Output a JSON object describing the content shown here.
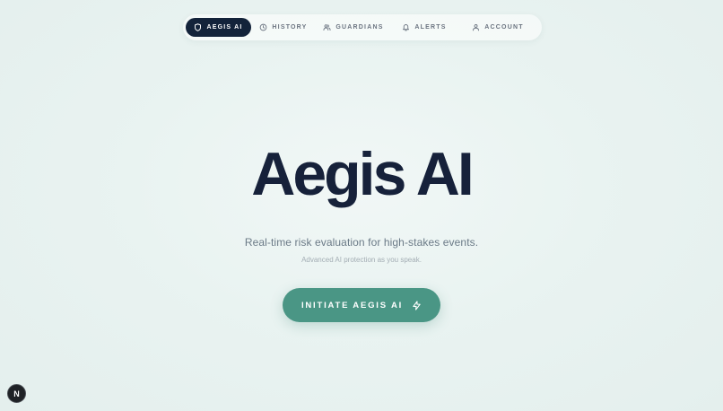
{
  "nav": {
    "items": [
      {
        "label": "AEGIS AI",
        "icon": "shield-icon",
        "active": true
      },
      {
        "label": "HISTORY",
        "icon": "clock-icon",
        "active": false
      },
      {
        "label": "GUARDIANS",
        "icon": "users-icon",
        "active": false
      },
      {
        "label": "ALERTS",
        "icon": "bell-icon",
        "active": false
      },
      {
        "label": "ACCOUNT",
        "icon": "user-icon",
        "active": false
      }
    ]
  },
  "hero": {
    "title": "Aegis AI",
    "subtitle": "Real-time risk evaluation for high-stakes events.",
    "tagline": "Advanced AI protection as you speak."
  },
  "cta": {
    "label": "INITIATE AEGIS AI",
    "icon": "zap-icon"
  },
  "badge": {
    "label": "N"
  },
  "colors": {
    "nav_active": "#13233a",
    "title": "#16213a",
    "cta": "#4a9685",
    "background": "#eaf4f2"
  }
}
